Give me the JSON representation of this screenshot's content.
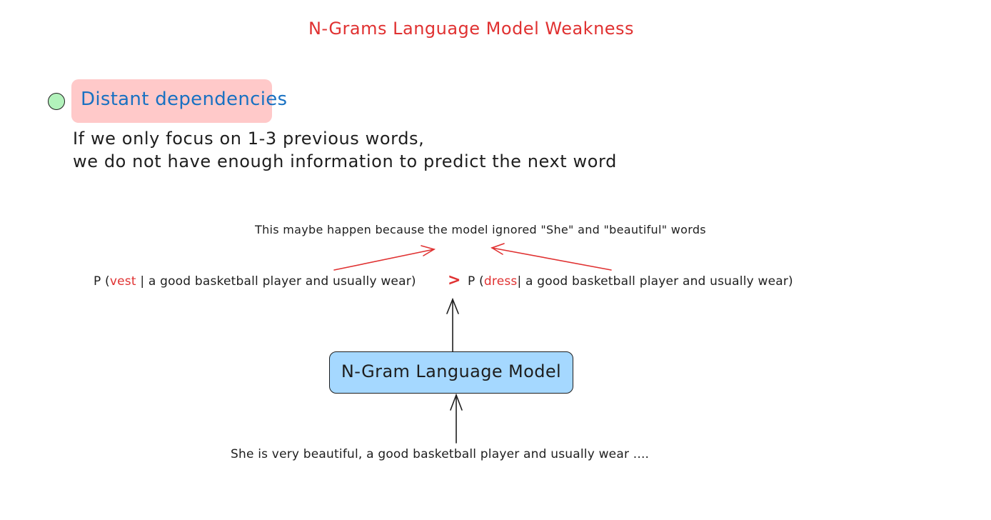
{
  "title": "N-Grams Language Model Weakness",
  "section": {
    "heading": "Distant dependencies",
    "body_line1": "If we only focus on 1-3 previous words,",
    "body_line2": "we do not have enough information to predict the next word"
  },
  "note": "This maybe happen because the model ignored \"She\" and \"beautiful\" words",
  "formula": {
    "left_prefix": "P (",
    "left_word": "vest",
    "left_rest": " | a good basketball player and usually wear)",
    "operator": ">",
    "right_prefix": "P (",
    "right_word": "dress",
    "right_rest": "| a good basketball player and usually wear)"
  },
  "model_label": "N-Gram Language Model",
  "input_sentence": "She is very beautiful, a good basketball player and usually wear ....",
  "colors": {
    "accent_red": "#e03131",
    "heading_blue": "#1971c2",
    "heading_bg": "#ffc9c9",
    "bullet_green": "#b2f2bb",
    "model_bg": "#a5d8ff",
    "ink": "#1e1e1e"
  }
}
